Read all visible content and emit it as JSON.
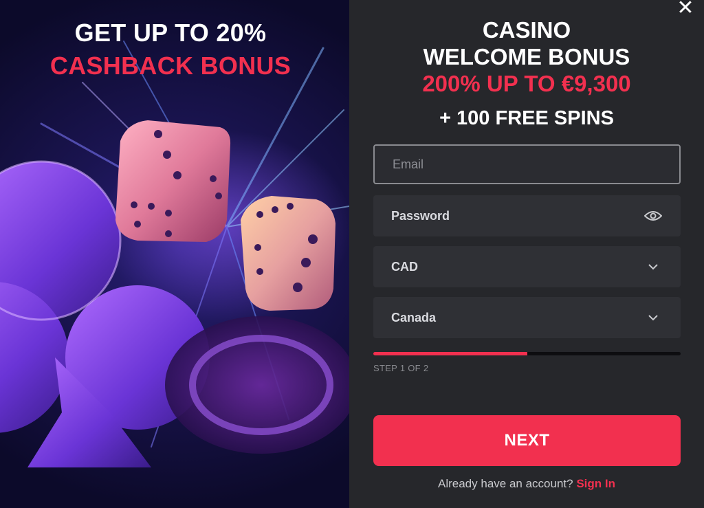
{
  "promo": {
    "title_line1": "GET UP TO 20%",
    "title_line2": "CASHBACK BONUS",
    "image_description_icons": [
      "dice-icon",
      "club-icon",
      "chip-icon"
    ]
  },
  "close": {
    "glyph": "✕",
    "icon": "close-icon"
  },
  "offer": {
    "line1": "CASINO",
    "line2": "WELCOME BONUS",
    "line3": "200% UP TO €9,300",
    "line4": "+ 100 FREE SPINS"
  },
  "form": {
    "email_placeholder": "Email",
    "password_label": "Password",
    "currency_value": "CAD",
    "country_value": "Canada"
  },
  "progress": {
    "fraction": 0.5,
    "step_text": "STEP 1 OF 2"
  },
  "next_label": "NEXT",
  "signin": {
    "prompt": "Already have an account?",
    "link": "Sign In"
  },
  "colors": {
    "accent": "#f2304f",
    "panel_bg": "#26272b",
    "field_bg": "#2f3035"
  }
}
